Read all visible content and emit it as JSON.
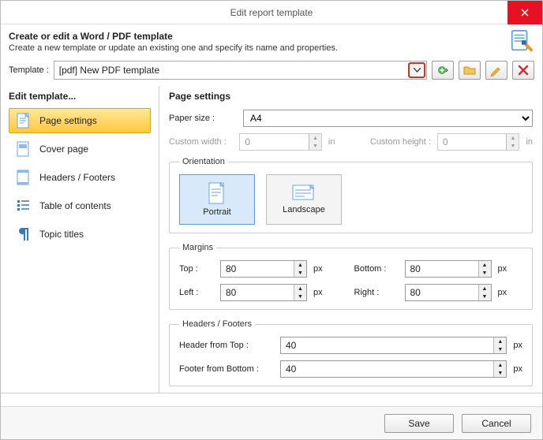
{
  "window": {
    "title": "Edit report template"
  },
  "header": {
    "title": "Create or edit a Word / PDF template",
    "subtitle": "Create a new template or update an existing one and specify its name and properties."
  },
  "templateRow": {
    "label": "Template :",
    "value": "[pdf] New PDF template"
  },
  "sidebar": {
    "title": "Edit template...",
    "items": [
      {
        "label": "Page settings"
      },
      {
        "label": "Cover page"
      },
      {
        "label": "Headers / Footers"
      },
      {
        "label": "Table of contents"
      },
      {
        "label": "Topic titles"
      }
    ]
  },
  "page": {
    "title": "Page settings",
    "paperSizeLabel": "Paper size :",
    "paperSize": "A4",
    "customWidthLabel": "Custom width :",
    "customWidth": "0",
    "customHeightLabel": "Custom height :",
    "customHeight": "0",
    "unitIn": "in",
    "unitPx": "px",
    "orientation": {
      "legend": "Orientation",
      "portrait": "Portrait",
      "landscape": "Landscape"
    },
    "margins": {
      "legend": "Margins",
      "top": {
        "label": "Top :",
        "value": "80"
      },
      "bottom": {
        "label": "Bottom :",
        "value": "80"
      },
      "left": {
        "label": "Left :",
        "value": "80"
      },
      "right": {
        "label": "Right :",
        "value": "80"
      }
    },
    "hf": {
      "legend": "Headers / Footers",
      "header": {
        "label": "Header from Top :",
        "value": "40"
      },
      "footer": {
        "label": "Footer from Bottom :",
        "value": "40"
      }
    }
  },
  "footer": {
    "save": "Save",
    "cancel": "Cancel"
  }
}
